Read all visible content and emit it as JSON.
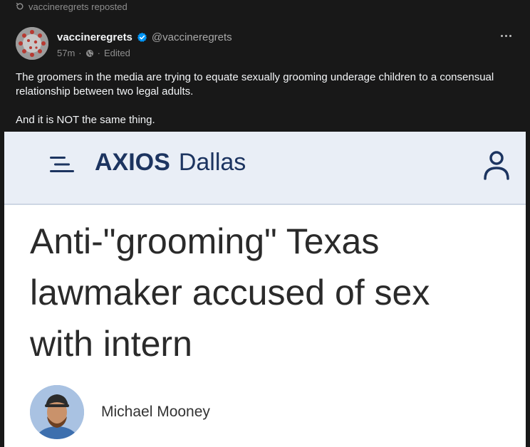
{
  "repost": {
    "label": "vaccineregrets reposted"
  },
  "post": {
    "display_name": "vaccineregrets",
    "handle": "@vaccineregrets",
    "time": "57m",
    "separator": "·",
    "edited": "Edited",
    "text_paragraphs": [
      "The groomers in the media are trying to equate sexually grooming underage children to a consensual relationship between two legal adults.",
      "And it is NOT the same thing."
    ]
  },
  "embed": {
    "outlet": "AXIOS",
    "city": "Dallas",
    "headline": "Anti-\"grooming\" Texas lawmaker accused of sex with intern",
    "author": "Michael Mooney"
  },
  "icons": {
    "repost": "repost-icon",
    "verified": "verified-badge-icon",
    "globe": "globe-icon",
    "more": "more-options-icon",
    "menu": "hamburger-menu-icon",
    "user": "user-account-icon"
  },
  "colors": {
    "background": "#181818",
    "text_primary": "#f3f5f7",
    "text_secondary": "#8e8e8e",
    "verified_blue": "#0095f6",
    "axios_header_bg": "#e9eef6",
    "axios_navy": "#1c3460"
  }
}
